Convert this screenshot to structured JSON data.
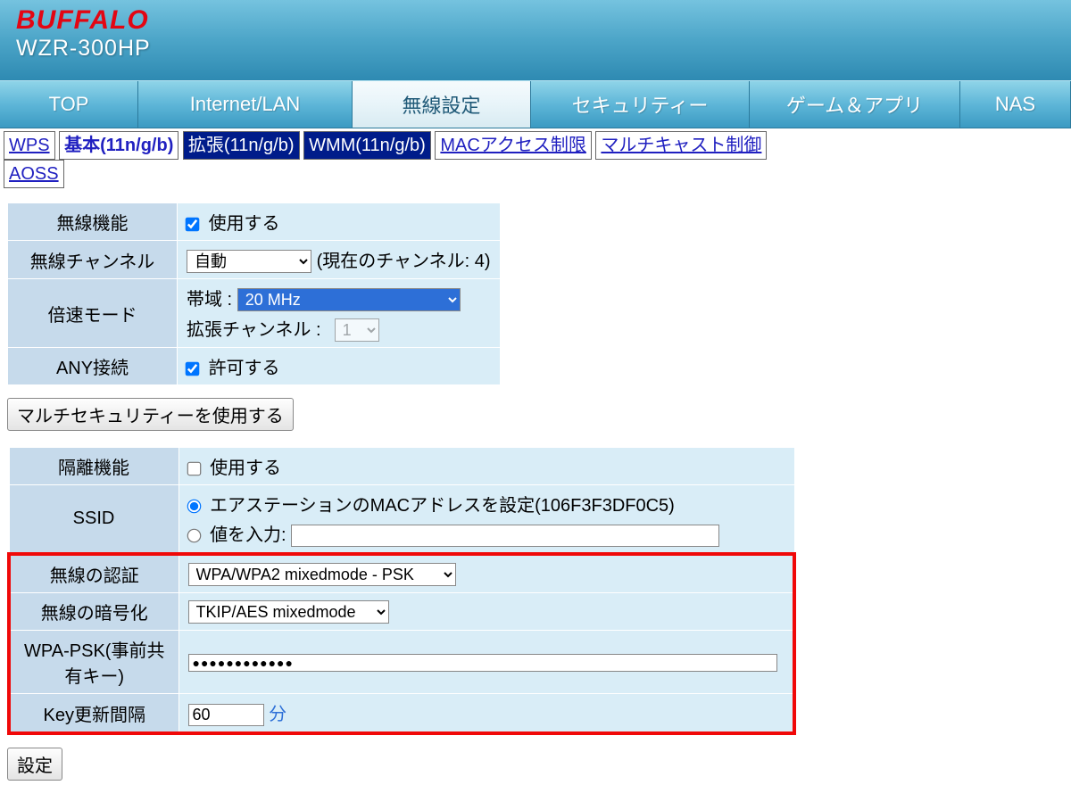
{
  "header": {
    "brand": "BUFFALO",
    "model": "WZR-300HP"
  },
  "nav": {
    "top": "TOP",
    "internet": "Internet/LAN",
    "wireless": "無線設定",
    "security": "セキュリティー",
    "game": "ゲーム＆アプリ",
    "nas": "NAS"
  },
  "subnav": {
    "wps": "WPS",
    "basic": "基本(11n/g/b)",
    "advanced": "拡張(11n/g/b)",
    "wmm": "WMM(11n/g/b)",
    "mac": "MACアクセス制限",
    "multicast": "マルチキャスト制御",
    "aoss": "AOSS"
  },
  "table1": {
    "wireless_func": {
      "label": "無線機能",
      "opt": "使用する"
    },
    "channel": {
      "label": "無線チャンネル",
      "value": "自動",
      "note": "(現在のチャンネル: 4)"
    },
    "speed_mode": {
      "label": "倍速モード",
      "band_label": "帯域 :",
      "band_value": "20 MHz",
      "ext_label": "拡張チャンネル :",
      "ext_value": "1"
    },
    "any": {
      "label": "ANY接続",
      "opt": "許可する"
    }
  },
  "multi_security_btn": "マルチセキュリティーを使用する",
  "table2": {
    "isolation": {
      "label": "隔離機能",
      "opt": "使用する"
    },
    "ssid": {
      "label": "SSID",
      "opt1": "エアステーションのMACアドレスを設定(106F3F3DF0C5)",
      "opt2": "値を入力:"
    },
    "auth": {
      "label": "無線の認証",
      "value": "WPA/WPA2 mixedmode - PSK"
    },
    "encrypt": {
      "label": "無線の暗号化",
      "value": "TKIP/AES mixedmode"
    },
    "psk": {
      "label": "WPA-PSK(事前共有キー)",
      "value": "●●●●●●●●●●●●"
    },
    "rekey": {
      "label": "Key更新間隔",
      "value": "60",
      "unit": "分"
    }
  },
  "submit_btn": "設定"
}
